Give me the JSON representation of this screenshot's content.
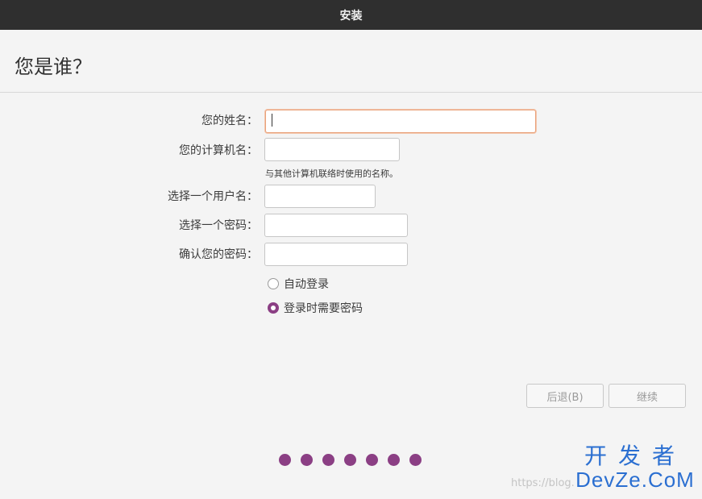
{
  "window": {
    "title": "安装"
  },
  "page": {
    "title": "您是谁？"
  },
  "form": {
    "name_label": "您的姓名：",
    "name_value": "",
    "computer_label": "您的计算机名：",
    "computer_value": "",
    "computer_hint": "与其他计算机联络时使用的名称。",
    "username_label": "选择一个用户名：",
    "username_value": "",
    "password_label": "选择一个密码：",
    "password_value": "",
    "confirm_label": "确认您的密码：",
    "confirm_value": ""
  },
  "login": {
    "auto_label": "自动登录",
    "auto_checked": false,
    "require_password_label": "登录时需要密码",
    "require_password_checked": true
  },
  "buttons": {
    "back": "后退(B)",
    "continue": "继续"
  },
  "progress": {
    "total_steps": 7
  },
  "watermark": {
    "url": "https://blog.",
    "logo_cn": "开发者",
    "logo_en": "DevZe.CoM"
  },
  "colors": {
    "accent": "#8b3f84",
    "focus_border": "#e9a27b",
    "titlebar": "#2f2f2f"
  }
}
